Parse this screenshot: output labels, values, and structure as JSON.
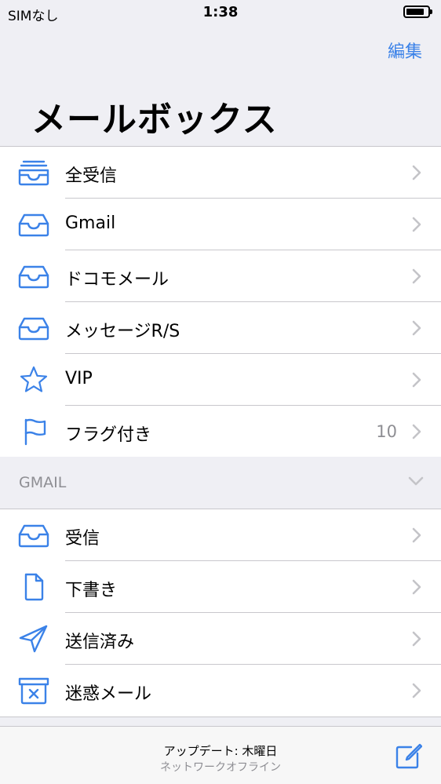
{
  "status_bar": {
    "carrier": "SIMなし",
    "time": "1:38"
  },
  "navbar": {
    "edit_label": "編集",
    "title": "メールボックス"
  },
  "mailboxes": [
    {
      "label": "全受信",
      "icon": "all-inboxes-icon",
      "count": ""
    },
    {
      "label": "Gmail",
      "icon": "inbox-icon",
      "count": ""
    },
    {
      "label": "ドコモメール",
      "icon": "inbox-icon",
      "count": ""
    },
    {
      "label": "メッセージR/S",
      "icon": "inbox-icon",
      "count": ""
    },
    {
      "label": "VIP",
      "icon": "star-icon",
      "count": ""
    },
    {
      "label": "フラグ付き",
      "icon": "flag-icon",
      "count": "10"
    }
  ],
  "gmail_section": {
    "header": "GMAIL",
    "folders": [
      {
        "label": "受信",
        "icon": "inbox-icon"
      },
      {
        "label": "下書き",
        "icon": "document-icon"
      },
      {
        "label": "送信済み",
        "icon": "paper-plane-icon"
      },
      {
        "label": "迷惑メール",
        "icon": "junk-box-icon"
      }
    ]
  },
  "toolbar": {
    "update_text": "アップデート: 木曜日",
    "status_text": "ネットワークオフライン"
  },
  "colors": {
    "accent": "#3b82e8",
    "background": "#efeff4",
    "secondary_text": "#8e8e93"
  }
}
